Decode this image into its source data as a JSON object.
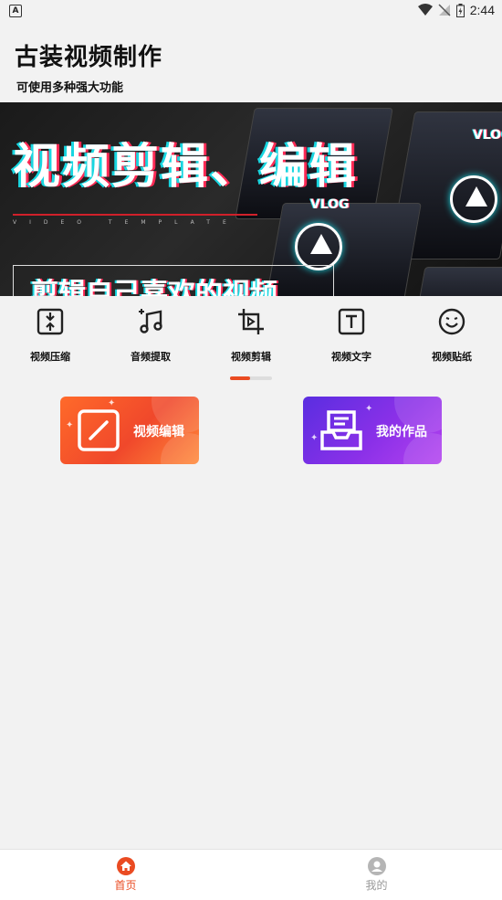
{
  "status_bar": {
    "time": "2:44",
    "left_icon": "A"
  },
  "header": {
    "title": "古装视频制作",
    "subtitle": "可使用多种强大功能"
  },
  "banner": {
    "headline": "视频剪辑、编辑",
    "template_text": "VIDEO TEMPLATE",
    "subline": "剪辑自己喜欢的视频",
    "card_text": "VLOG"
  },
  "tools": [
    {
      "label": "视频压缩",
      "icon": "compress-icon"
    },
    {
      "label": "音频提取",
      "icon": "music-icon"
    },
    {
      "label": "视频剪辑",
      "icon": "crop-icon"
    },
    {
      "label": "视频文字",
      "icon": "text-icon"
    },
    {
      "label": "视频贴纸",
      "icon": "sticker-icon"
    }
  ],
  "tools_page_indicator": {
    "current": 1,
    "total": 2
  },
  "actions": {
    "edit": {
      "label": "视频编辑",
      "icon": "edit-icon",
      "color": "#f0482b"
    },
    "works": {
      "label": "我的作品",
      "icon": "inbox-icon",
      "color": "#8a30e8"
    }
  },
  "bottom_nav": [
    {
      "label": "首页",
      "icon": "home-icon",
      "active": true
    },
    {
      "label": "我的",
      "icon": "user-icon",
      "active": false
    }
  ],
  "colors": {
    "accent": "#ea4b22",
    "background": "#f2f2f2"
  }
}
